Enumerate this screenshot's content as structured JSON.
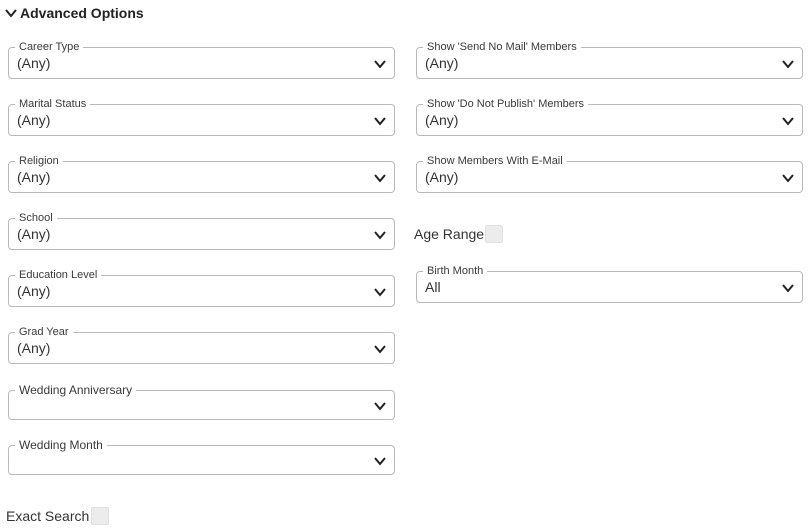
{
  "section": {
    "title": "Advanced Options"
  },
  "left_fields": [
    {
      "label": "Career Type",
      "value": "(Any)"
    },
    {
      "label": "Marital Status",
      "value": "(Any)"
    },
    {
      "label": "Religion",
      "value": "(Any)"
    },
    {
      "label": "School",
      "value": "(Any)"
    },
    {
      "label": "Education Level",
      "value": "(Any)"
    },
    {
      "label": "Grad Year",
      "value": "(Any)"
    },
    {
      "label": "Wedding Anniversary",
      "value": ""
    },
    {
      "label": "Wedding Month",
      "value": ""
    }
  ],
  "right_fields": [
    {
      "label": "Show 'Send No Mail' Members",
      "value": "(Any)"
    },
    {
      "label": "Show 'Do Not Publish' Members",
      "value": "(Any)"
    },
    {
      "label": "Show Members With E-Mail",
      "value": "(Any)"
    },
    {
      "label": "Birth Month",
      "value": "All"
    }
  ],
  "age_range": {
    "label": "Age Range"
  },
  "exact_search": {
    "label": "Exact Search"
  },
  "icons": {
    "collapse": "chevron-down-icon",
    "dropdown": "chevron-down-icon"
  }
}
